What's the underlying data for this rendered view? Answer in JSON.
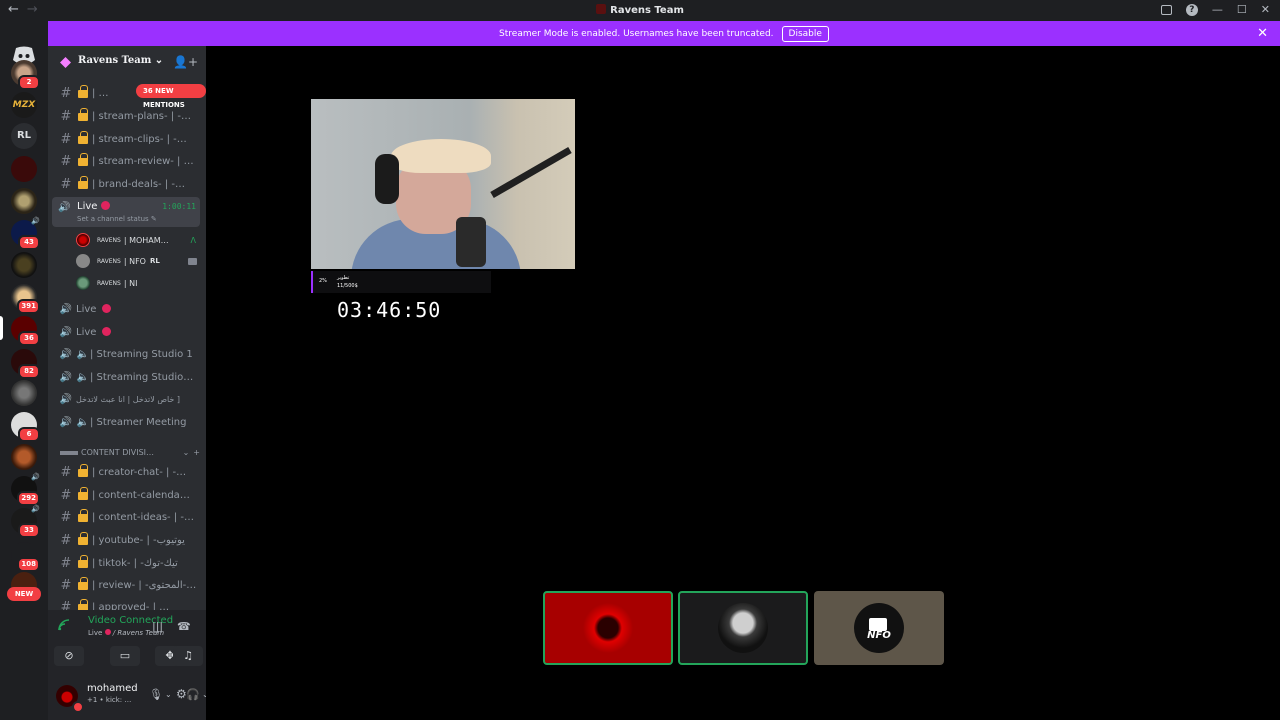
{
  "window": {
    "title": "Ravens Team"
  },
  "banner": {
    "text": "Streamer Mode is enabled. Usernames have been truncated.",
    "disable_label": "Disable"
  },
  "guilds": {
    "rl_label": "RL",
    "mzx_label": "MZX",
    "new_label": "NEW",
    "badges": [
      "2",
      "43",
      "391",
      "36",
      "82",
      "6",
      "292",
      "33",
      "108"
    ]
  },
  "server": {
    "name": "Ravens Team"
  },
  "mentions": "36 NEW MENTIONS",
  "channels": {
    "top": [
      {
        "label": "| …"
      },
      {
        "label": "| stream-plans- | -…"
      },
      {
        "label": "| stream-clips- | -…"
      },
      {
        "label": "| stream-review- | …"
      },
      {
        "label": "| brand-deals- | -…"
      }
    ],
    "live_active": {
      "label": "Live",
      "timer": "1:00:11",
      "status": "Set a channel status"
    },
    "voice_users": [
      {
        "tag": "RAVENS",
        "name": "| MOHAM…"
      },
      {
        "tag": "RAVENS",
        "name": "| NFO",
        "extra": "RL"
      },
      {
        "tag": "RAVENS",
        "name": "| NI"
      }
    ],
    "voice": [
      {
        "label": "Live"
      },
      {
        "label": "Live"
      },
      {
        "label": "| Streaming Studio 1"
      },
      {
        "label": "| Streaming Studio…"
      },
      {
        "label": "خاص لاتدخل | انا عبث لاتدخل ]"
      },
      {
        "label": "| Streamer Meeting"
      }
    ],
    "category": "CONTENT DIVISI…",
    "bottom": [
      {
        "label": "| creator-chat- | -…"
      },
      {
        "label": "| content-calenda…"
      },
      {
        "label": "| content-ideas- | -…"
      },
      {
        "label": "| youtube- | -يوتيوب"
      },
      {
        "label": "| tiktok- | -تيك-توك"
      },
      {
        "label": "| review- | -المحتوى-…"
      },
      {
        "label": "| approved- | …"
      }
    ]
  },
  "voice_panel": {
    "status": "Video Connected",
    "channel": "Live",
    "server": "/ Ravens Team"
  },
  "user": {
    "name": "mohamed",
    "status": "+1 • kick: …"
  },
  "stream": {
    "overlay_pct": "2%",
    "overlay_line1": "تطوير",
    "overlay_line2": "11/500$",
    "countdown": "03:46:50"
  },
  "tiles": {
    "t3_label": "NFO"
  },
  "colors": {
    "accent": "#9b30ff",
    "green": "#23a55a",
    "red": "#f23f43",
    "lock": "#f0b232"
  }
}
